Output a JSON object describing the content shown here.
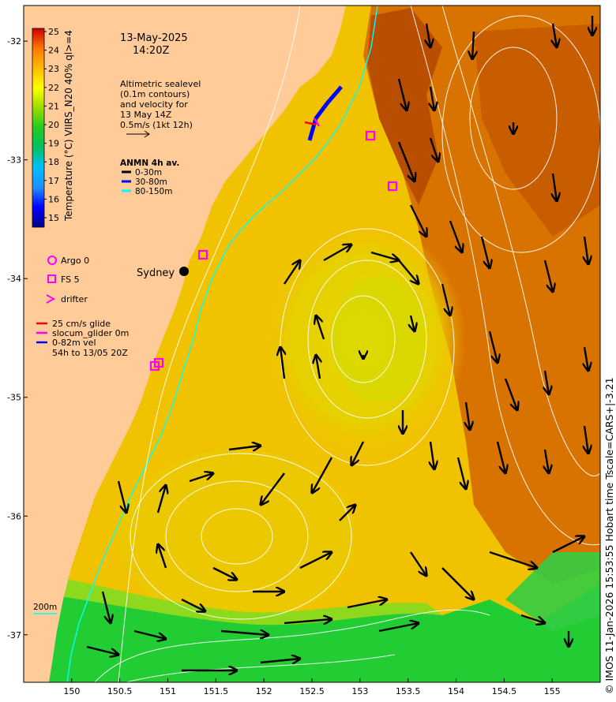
{
  "header": {
    "date": "13-May-2025",
    "time": "14:20Z"
  },
  "altimetry_note": {
    "lines": [
      "Altimetric sealevel",
      "(0.1m contours)",
      "and velocity for",
      "13 May 14Z",
      "0.5m/s (1kt 12h)"
    ]
  },
  "anmn_legend": {
    "title": "ANMN 4h av.",
    "items": [
      {
        "label": "0-30m",
        "color": "#000000"
      },
      {
        "label": "30-80m",
        "color": "#0000ff"
      },
      {
        "label": "80-150m",
        "color": "#00ffff"
      }
    ]
  },
  "platform_legend": {
    "argo": "Argo 0",
    "fs": "FS 5",
    "drifter": "drifter",
    "glider_lines": [
      "25 cm/s glide",
      "slocum_glider 0m",
      "0-82m vel",
      "54h to 13/05 20Z"
    ],
    "marker_color": "#ff00ff"
  },
  "places": {
    "sydney": "Sydney"
  },
  "isobath_label": "200m",
  "colorbar": {
    "title": "Temperature (°C) VIIRS_N20 40% ql>=4",
    "ticks": [
      "25",
      "24",
      "23",
      "22",
      "21",
      "20",
      "19",
      "18",
      "17",
      "16",
      "15"
    ],
    "range": [
      15,
      25
    ],
    "colors": [
      "#00008b",
      "#0000ff",
      "#1e90ff",
      "#00bfff",
      "#00c8a0",
      "#00c040",
      "#22cc22",
      "#7fdd00",
      "#ccee00",
      "#ffff00",
      "#ffd000",
      "#ffa500",
      "#ff8800",
      "#ff5500",
      "#cc0000"
    ]
  },
  "axes": {
    "x_ticks": [
      "150",
      "150.5",
      "151",
      "151.5",
      "152",
      "152.5",
      "153",
      "153.5",
      "154",
      "154.5",
      "155"
    ],
    "y_ticks": [
      "-32",
      "-33",
      "-34",
      "-35",
      "-36",
      "-37"
    ],
    "lon_range": [
      149.5,
      155.5
    ],
    "lat_range": [
      -37.4,
      -31.7
    ]
  },
  "credit": "© IMOS 11-Jan-2026 15:53:55 Hobart time Tscale=CARS+|-3.21",
  "colors": {
    "land": "#ffcc99",
    "shelf_sst": "#f2c400",
    "warm_offshore": "#d97300",
    "hot_core": "#b34700",
    "cool_south": "#22cc33",
    "contour": "#ffffff",
    "isobath": "#00ffff"
  }
}
